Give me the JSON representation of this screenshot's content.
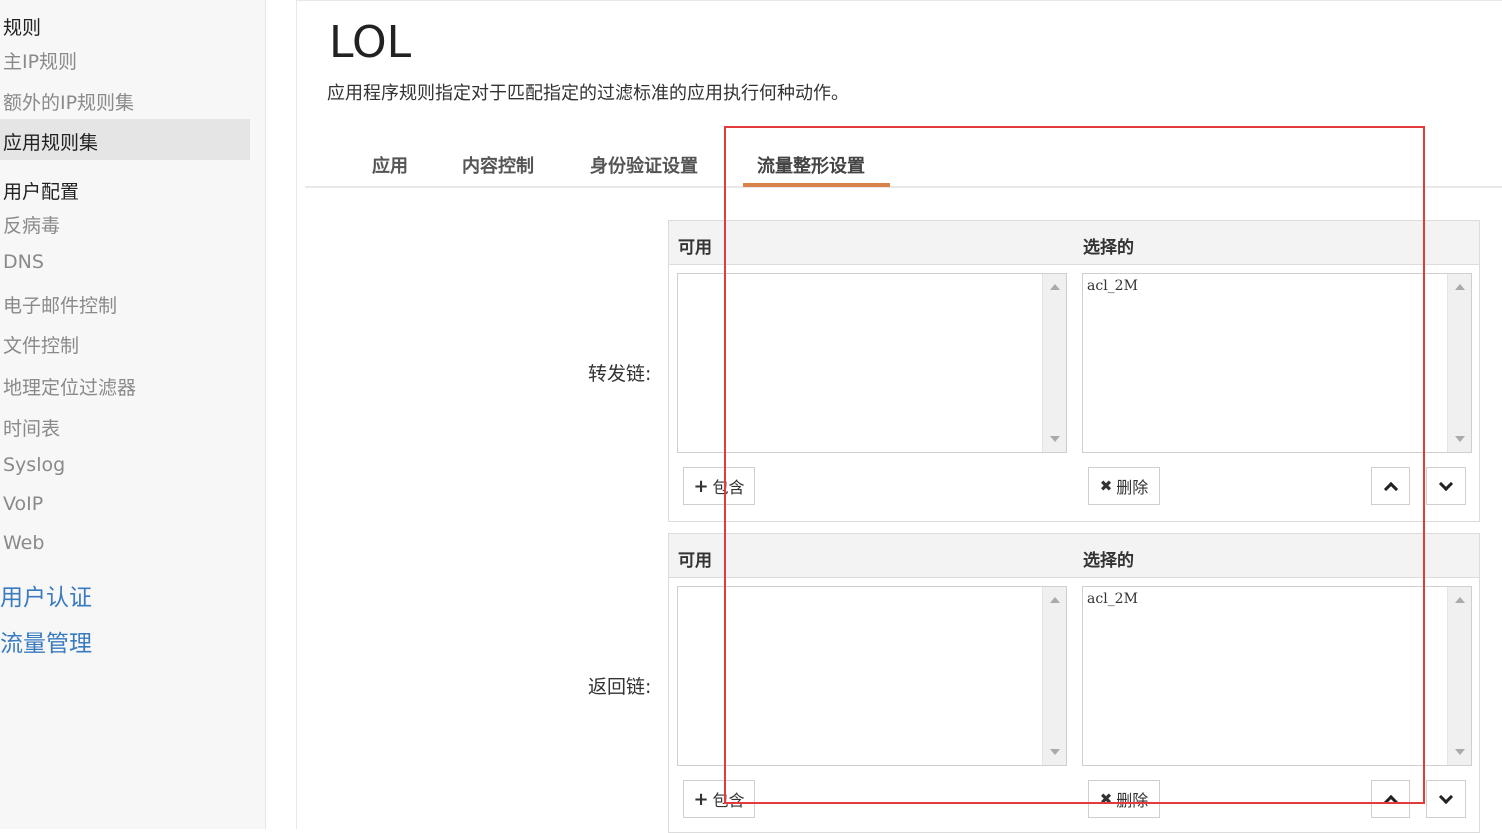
{
  "sidebar": {
    "rules_heading": "规则",
    "rules_items": [
      "主IP规则",
      "额外的IP规则集",
      "应用规则集"
    ],
    "user_config_heading": "用户配置",
    "user_config_items": [
      "反病毒",
      "DNS",
      "电子邮件控制",
      "文件控制",
      "地理定位过滤器",
      "时间表",
      "Syslog",
      "VoIP",
      "Web"
    ],
    "sections": [
      "用户认证",
      "流量管理"
    ]
  },
  "main": {
    "title": "LOL",
    "description": "应用程序规则指定对于匹配指定的过滤标准的应用执行何种动作。",
    "tabs": [
      "应用",
      "内容控制",
      "身份验证设置",
      "流量整形设置"
    ],
    "active_tab": "流量整形设置",
    "forward_chain": {
      "label": "转发链:",
      "available_header": "可用",
      "selected_header": "选择的",
      "available_items": [],
      "selected_items": [
        "acl_2M"
      ],
      "include_button": "包含",
      "remove_button": "删除"
    },
    "return_chain": {
      "label": "返回链:",
      "available_header": "可用",
      "selected_header": "选择的",
      "available_items": [],
      "selected_items": [
        "acl_2M"
      ],
      "include_button": "包含",
      "remove_button": "删除"
    }
  },
  "colors": {
    "accent_tab": "#d9834a",
    "link_blue": "#3a7bbf",
    "highlight_red": "#e33b3b"
  }
}
